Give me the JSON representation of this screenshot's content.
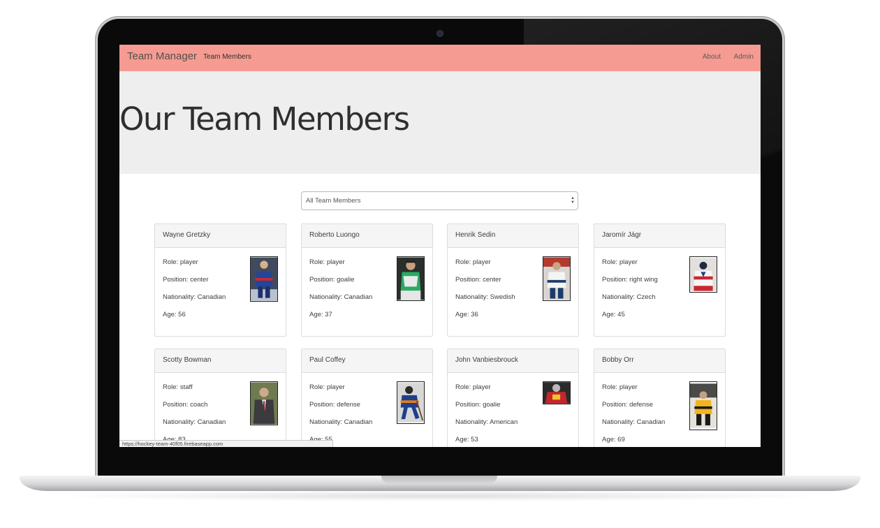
{
  "navbar": {
    "brand": "Team Manager",
    "team_members_link": "Team Members",
    "about_link": "About",
    "admin_link": "Admin"
  },
  "jumbotron": {
    "title": "Our Team Members"
  },
  "filter": {
    "selected": "All Team Members"
  },
  "members": [
    {
      "name": "Wayne Gretzky",
      "role": "Role: player",
      "position": "Position: center",
      "nationality": "Nationality: Canadian",
      "age": "Age: 56"
    },
    {
      "name": "Roberto Luongo",
      "role": "Role: player",
      "position": "Position: goalie",
      "nationality": "Nationality: Canadian",
      "age": "Age: 37"
    },
    {
      "name": "Henrik Sedin",
      "role": "Role: player",
      "position": "Position: center",
      "nationality": "Nationality: Swedish",
      "age": "Age: 36"
    },
    {
      "name": "Jaromír Jágr",
      "role": "Role: player",
      "position": "Position: right wing",
      "nationality": "Nationality: Czech",
      "age": "Age: 45"
    },
    {
      "name": "Scotty Bowman",
      "role": "Role: staff",
      "position": "Position: coach",
      "nationality": "Nationality: Canadian",
      "age": "Age: 83"
    },
    {
      "name": "Paul Coffey",
      "role": "Role: player",
      "position": "Position: defense",
      "nationality": "Nationality: Canadian",
      "age": "Age: 55"
    },
    {
      "name": "John Vanbiesbrouck",
      "role": "Role: player",
      "position": "Position: goalie",
      "nationality": "Nationality: American",
      "age": "Age: 53"
    },
    {
      "name": "Bobby Orr",
      "role": "Role: player",
      "position": "Position: defense",
      "nationality": "Nationality: Canadian",
      "age": "Age: 69"
    }
  ],
  "status_bar": {
    "url": "https://hockey-team-40f05.firebaseapp.com"
  },
  "colors": {
    "navbar": "#f69b91",
    "jumbotron": "#eeeeee"
  }
}
